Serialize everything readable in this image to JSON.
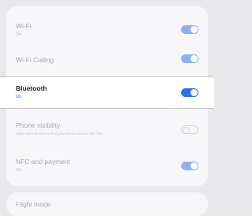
{
  "settings": {
    "wifi": {
      "label": "Wi-Fi",
      "status": "On",
      "enabled": true
    },
    "wifi_calling": {
      "label": "Wi-Fi Calling",
      "enabled": true
    },
    "bluetooth": {
      "label": "Bluetooth",
      "status": "On",
      "enabled": true
    },
    "phone_visibility": {
      "label": "Phone visibility",
      "description": "Allow other devices to find your phone and transfer files.",
      "enabled": false
    },
    "nfc": {
      "label": "NFC and payment",
      "status": "On",
      "enabled": true
    },
    "flight_mode": {
      "label": "Flight mode"
    }
  },
  "colors": {
    "accent": "#2f6fe6",
    "accent_dimmed": "#8fb0ee",
    "background": "#e9e9ec",
    "card": "#f7f7f9"
  }
}
